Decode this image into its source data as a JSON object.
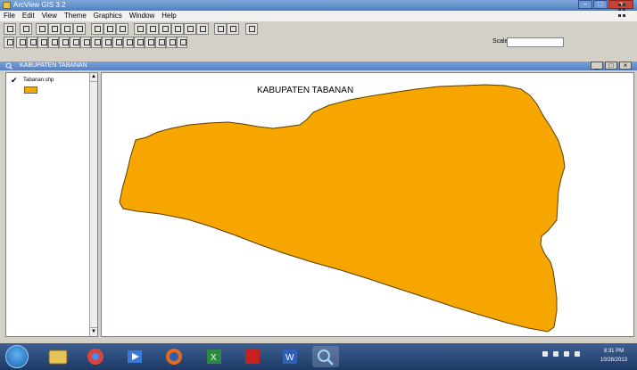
{
  "window": {
    "title": "ArcView GIS 3.2"
  },
  "menu": [
    "File",
    "Edit",
    "View",
    "Theme",
    "Graphics",
    "Window",
    "Help"
  ],
  "toolbar": {
    "scale_label": "Scale 1:",
    "scale_value": ""
  },
  "view": {
    "title": "KABUPATEN TABANAN"
  },
  "toc": {
    "layer_name": "Tabanan.shp",
    "layer_checked": true,
    "swatch_color": "#f5a800"
  },
  "map": {
    "title": "KABUPATEN TABANAN",
    "fill_color": "#f7a600"
  },
  "taskbar": {
    "apps": [
      "windows-explorer",
      "chrome",
      "media-player",
      "firefox",
      "excel",
      "acrobat",
      "word",
      "arcview"
    ],
    "clock_time": "8:31 PM",
    "clock_date": "10/28/2013"
  }
}
